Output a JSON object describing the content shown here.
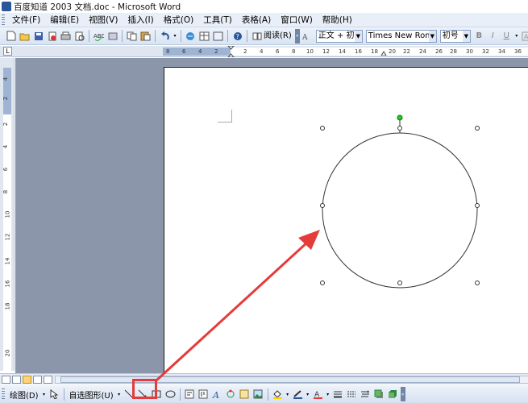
{
  "window": {
    "title": "百度知道 2003 文档.doc - Microsoft Word"
  },
  "menubar": {
    "items": [
      "文件(F)",
      "编辑(E)",
      "视图(V)",
      "插入(I)",
      "格式(O)",
      "工具(T)",
      "表格(A)",
      "窗口(W)",
      "帮助(H)"
    ]
  },
  "toolbar": {
    "read_label": "阅读(R)",
    "style_value": "正文 + 初号",
    "font_value": "Times New Roman",
    "size_value": "初号",
    "bold": "B",
    "italic": "I",
    "underline": "U"
  },
  "hruler": {
    "labels": [
      "8",
      "6",
      "4",
      "2",
      "2",
      "4",
      "6",
      "8",
      "10",
      "12",
      "14",
      "16",
      "18",
      "20",
      "22",
      "24",
      "26",
      "28",
      "30",
      "32",
      "34",
      "36"
    ]
  },
  "vruler": {
    "labels": [
      "4",
      "2",
      "2",
      "4",
      "6",
      "8",
      "10",
      "12",
      "14",
      "16",
      "18",
      "20"
    ]
  },
  "drawing_toolbar": {
    "draw_label": "绘图(D)",
    "autoshapes_label": "自选图形(U)"
  },
  "colors": {
    "annotation": "#e53b3b",
    "workspace": "#8c96ab",
    "rotate_handle": "#22cc22"
  },
  "icons": {
    "shape_tools": [
      "line-icon",
      "arrow-icon",
      "rectangle-icon",
      "oval-icon",
      "textbox-icon",
      "vertical-textbox-icon",
      "wordart-icon",
      "diagram-icon",
      "clipart-icon",
      "picture-icon"
    ],
    "format_tools": [
      "fill-color-icon",
      "line-color-icon",
      "font-color-icon",
      "line-style-icon",
      "dash-style-icon",
      "arrow-style-icon",
      "shadow-icon",
      "3d-icon"
    ]
  }
}
